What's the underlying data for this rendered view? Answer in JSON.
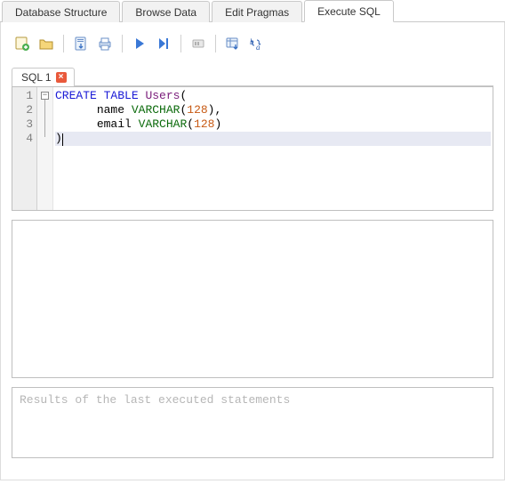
{
  "tabs": {
    "items": [
      {
        "label": "Database Structure"
      },
      {
        "label": "Browse Data"
      },
      {
        "label": "Edit Pragmas"
      },
      {
        "label": "Execute SQL"
      }
    ],
    "activeIndex": 3
  },
  "toolbar": {
    "icons": {
      "newTab": "new-sql-tab-icon",
      "open": "open-file-icon",
      "save": "save-file-icon",
      "print": "print-icon",
      "run": "run-icon",
      "runStep": "run-step-icon",
      "stop": "stop-icon",
      "saveResults": "save-results-icon",
      "find": "find-replace-icon"
    }
  },
  "sqlTabs": {
    "items": [
      {
        "label": "SQL 1"
      }
    ]
  },
  "editor": {
    "lineNumbers": [
      "1",
      "2",
      "3",
      "4"
    ],
    "currentLine": 4,
    "code": {
      "line1": {
        "kw1": "CREATE",
        "kw2": "TABLE",
        "ident": "Users",
        "open": "("
      },
      "line2": {
        "indent": "      ",
        "col": "name",
        "type": "VARCHAR",
        "open": "(",
        "num": "128",
        "close": "),"
      },
      "line3": {
        "indent": "      ",
        "col": "email",
        "type": "VARCHAR",
        "open": "(",
        "num": "128",
        "close": ")"
      },
      "line4": {
        "close": ")"
      }
    }
  },
  "log": {
    "placeholder": "Results of the last executed statements"
  }
}
